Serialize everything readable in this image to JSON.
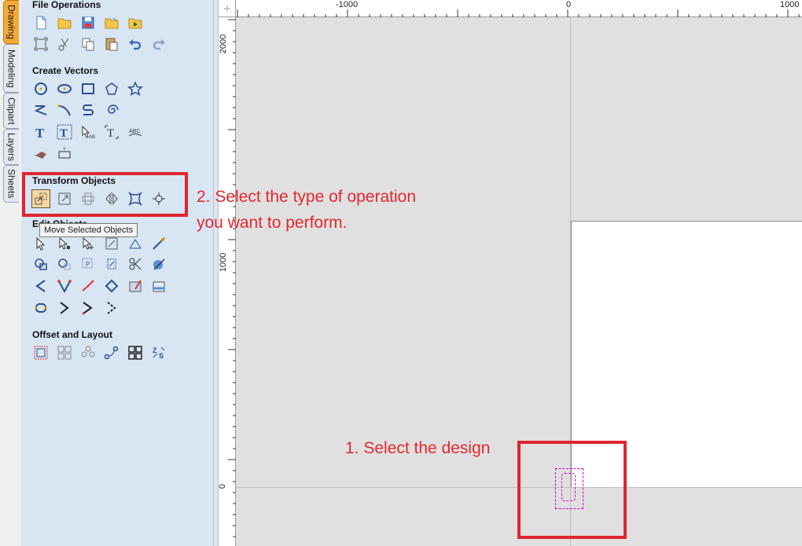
{
  "tabs": [
    "Drawing",
    "Modeling",
    "Clipart",
    "Layers",
    "Sheets"
  ],
  "sections": {
    "file_operations": "File Operations",
    "create_vectors": "Create Vectors",
    "transform_objects": "Transform Objects",
    "edit_objects": "Edit Objects",
    "offset_layout": "Offset and Layout"
  },
  "tooltip": "Move Selected Objects",
  "ruler": {
    "h_labels": [
      "-1000",
      "0",
      "1000"
    ],
    "v_labels": [
      "2000",
      "1000",
      "0"
    ]
  },
  "annotations": {
    "step2": "2. Select the type of operation you want to perform.",
    "step1": "1. Select the design"
  },
  "icons": {
    "file_row1": [
      "new-file-icon",
      "open-folder-icon",
      "save-icon",
      "open-folder-2-icon",
      "import-icon"
    ],
    "file_row2": [
      "fit-view-icon",
      "cut-icon",
      "copy-icon",
      "paste-icon",
      "undo-icon",
      "redo-icon"
    ],
    "vec_row1": [
      "circle-icon",
      "ellipse-icon",
      "rectangle-icon",
      "polygon-icon",
      "star-icon"
    ],
    "vec_row2": [
      "polyline-icon",
      "arc-icon",
      "curve-icon",
      "spiral-icon"
    ],
    "vec_row3": [
      "text-icon",
      "text-block-icon",
      "text-on-curve-icon",
      "text-auto-layout-icon",
      "text-arc-icon"
    ],
    "vec_row4": [
      "dimension-icon",
      "measure-icon"
    ],
    "transform_row": [
      "move-icon",
      "scale-icon",
      "align-icon",
      "mirror-icon",
      "distort-icon",
      "center-icon"
    ],
    "edit_row1": [
      "select-icon",
      "node-edit-icon",
      "transform-mode-icon",
      "interactive-trim-icon",
      "weld-icon",
      "smooth-icon"
    ],
    "edit_row2": [
      "join-icon",
      "close-vector-icon",
      "group-icon",
      "ungroup-icon",
      "trim-icon",
      "fillet-icon"
    ],
    "edit_row3": [
      "corner-icon",
      "vertex-icon",
      "line-smooth-icon",
      "fit-curves-icon",
      "vector-texture-icon",
      "image-icon"
    ],
    "edit_row4": [
      "closed-node-icon",
      "chevron-icon",
      "arrow-curve-icon",
      "dotted-curve-icon"
    ],
    "offset_row": [
      "offset-icon",
      "array-copy-icon",
      "circular-array-icon",
      "nesting-icon",
      "grid-icon",
      "nest-parts-icon"
    ]
  },
  "colors": {
    "panel": "#d8e5f3",
    "accent": "#f4a938",
    "annotation": "#e02830",
    "selection": "#d000d0"
  }
}
